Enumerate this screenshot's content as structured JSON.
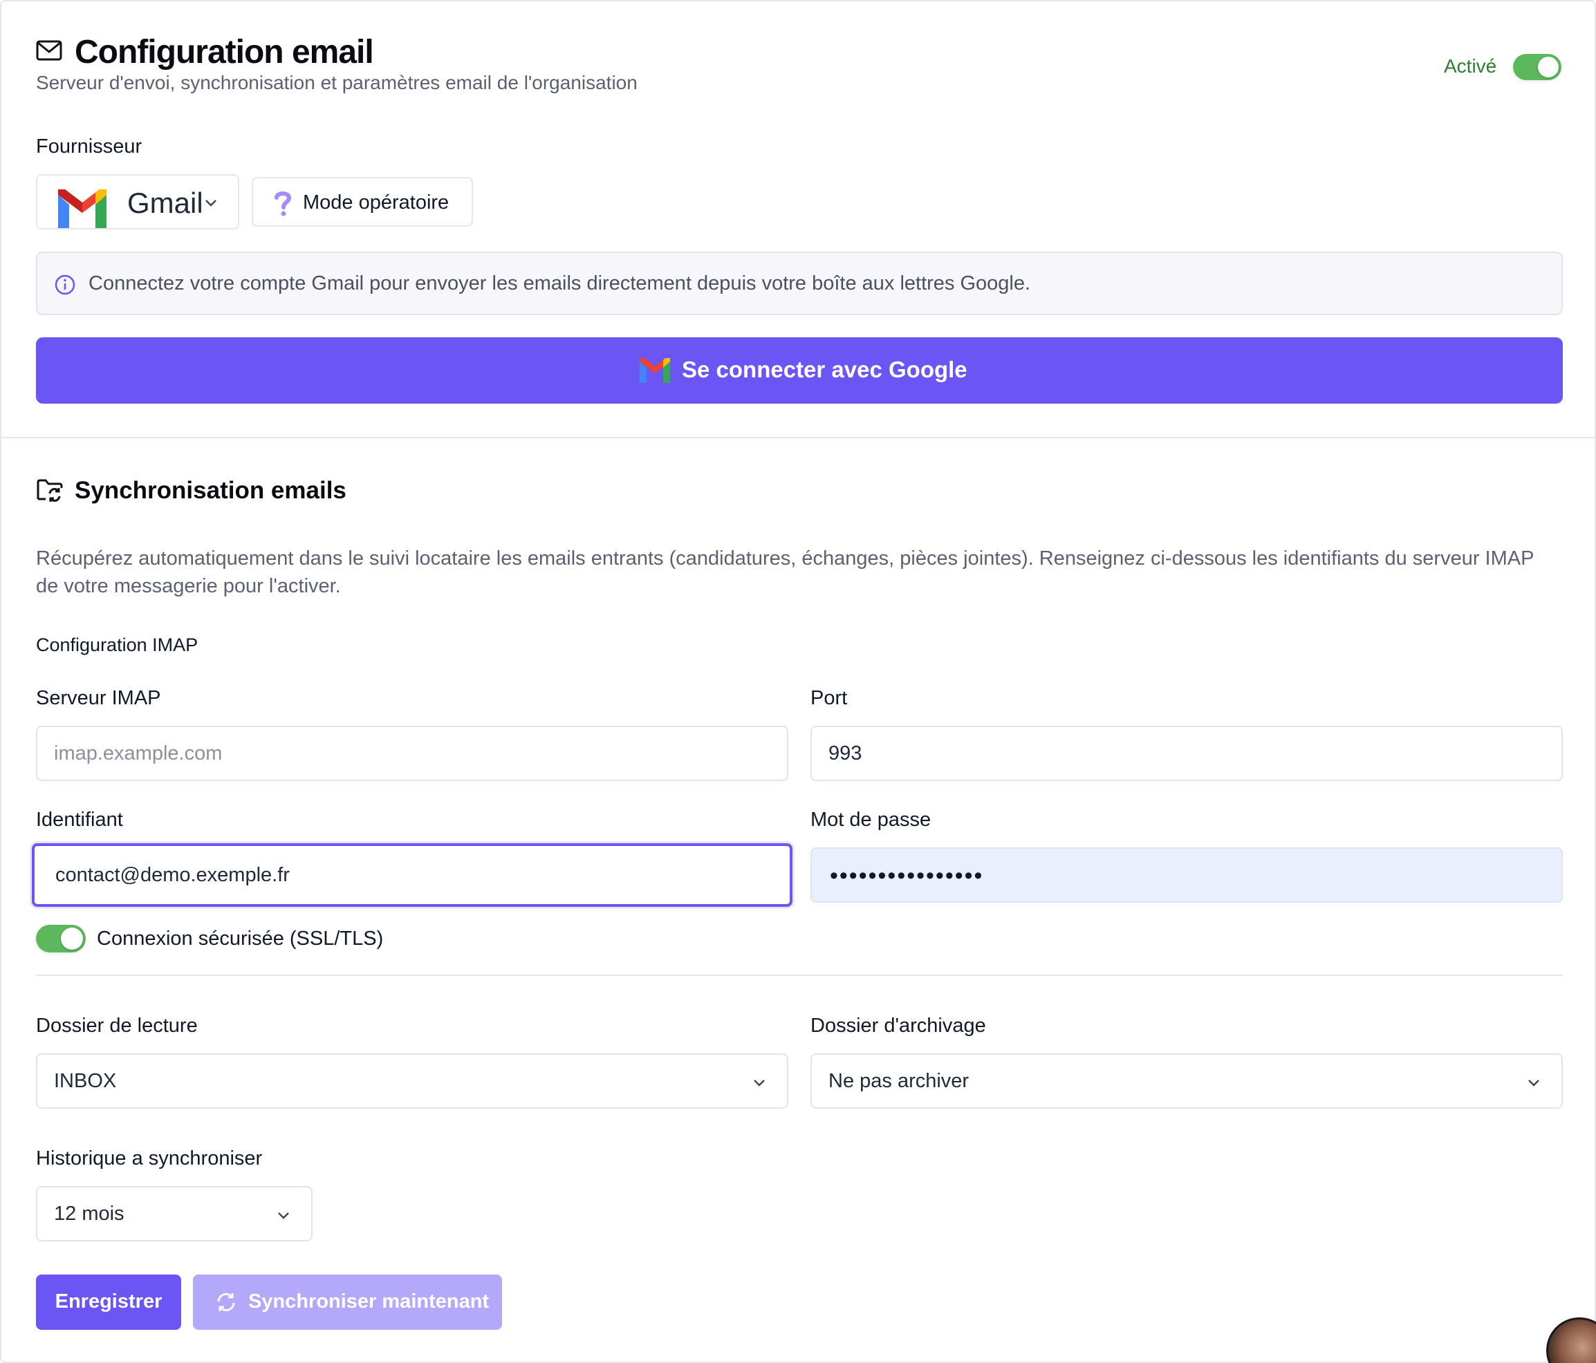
{
  "header": {
    "title": "Configuration email",
    "subtitle": "Serveur d'envoi, synchronisation et paramètres email de l'organisation",
    "status_label": "Activé",
    "enabled": true,
    "icon": "mail-icon"
  },
  "provider": {
    "label": "Fournisseur",
    "selected": "Gmail",
    "mode_button": "Mode opératoire",
    "info_text": "Connectez votre compte Gmail pour envoyer les emails directement depuis votre boîte aux lettres Google.",
    "connect_button": "Se connecter avec Google"
  },
  "sync": {
    "title": "Synchronisation emails",
    "description": "Récupérez automatiquement dans le suivi locataire les emails entrants (candidatures, échanges, pièces jointes). Renseignez ci-dessous les identifiants du serveur IMAP de votre messagerie pour l'activer.",
    "imap_title": "Configuration IMAP",
    "server_label": "Serveur IMAP",
    "server_placeholder": "imap.example.com",
    "server_value": "",
    "port_label": "Port",
    "port_value": "993",
    "user_label": "Identifiant",
    "user_value": "contact@demo.exemple.fr",
    "password_label": "Mot de passe",
    "password_mask": "••••••••••••••••",
    "ssl_label": "Connexion sécurisée (SSL/TLS)",
    "ssl_enabled": true,
    "read_folder_label": "Dossier de lecture",
    "read_folder_value": "INBOX",
    "archive_folder_label": "Dossier d'archivage",
    "archive_folder_value": "Ne pas archiver",
    "history_label": "Historique a synchroniser",
    "history_value": "12 mois",
    "save_button": "Enregistrer",
    "sync_button": "Synchroniser maintenant"
  },
  "colors": {
    "accent": "#6c55f5",
    "accent_disabled": "#b3a8fa",
    "toggle_on": "#5cb85c",
    "status_text": "#2f7d32"
  }
}
